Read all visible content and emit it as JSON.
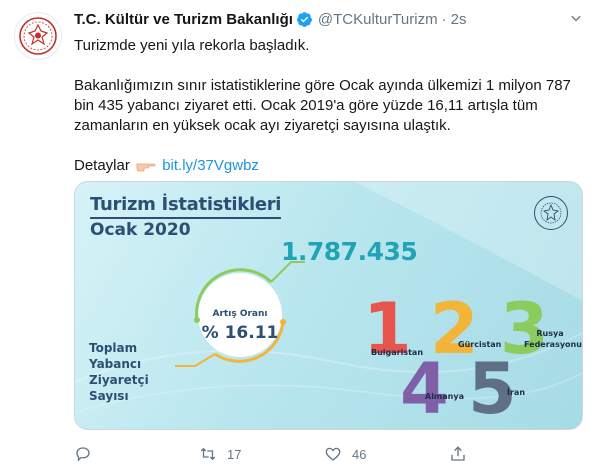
{
  "author": {
    "name": "T.C. Kültür ve Turizm Bakanlığı",
    "handle": "@TCKulturTurizm",
    "separator": "·",
    "time": "2s"
  },
  "tweet": {
    "line1": "Turizmde yeni yıla rekorla başladık.",
    "line2": "Bakanlığımızın sınır istatistiklerine göre Ocak ayında ülkemizi 1 milyon 787 bin 435 yabancı ziyaret etti. Ocak 2019'a göre yüzde 16,11 artışla tüm zamanların en yüksek ocak ayı ziyaretçi sayısına ulaştık.",
    "details_label": "Detaylar",
    "link": "bit.ly/37Vgwbz"
  },
  "card": {
    "title": "Turizm İstatistikleri",
    "subtitle": "Ocak 2020",
    "total": "1.787.435",
    "rate_label": "Artış Oranı",
    "rate_value": "% 16.11",
    "visitor_label_1": "Toplam Yabancı",
    "visitor_label_2": "Ziyaretçi Sayısı",
    "ranks": [
      {
        "num": "1",
        "country": "Bulgaristan",
        "color": "#e8554e"
      },
      {
        "num": "2",
        "country": "Gürcistan",
        "color": "#f3b43a"
      },
      {
        "num": "3",
        "country": "Rusya Federasyonu",
        "color": "#8ccb5e"
      },
      {
        "num": "4",
        "country": "Almanya",
        "color": "#7e5fa8"
      },
      {
        "num": "5",
        "country": "İran",
        "color": "#5f6f86"
      }
    ]
  },
  "actions": {
    "reply_count": "",
    "retweet_count": "17",
    "like_count": "46"
  },
  "colors": {
    "link": "#1b95e0",
    "verified": "#1da1f2",
    "muted": "#657786",
    "card_text": "#2c4f74",
    "card_accent": "#1fa3b5"
  },
  "icons": [
    "emblem-icon",
    "verified-badge-icon",
    "chevron-down-icon",
    "pointing-hand-emoji",
    "reply-icon",
    "retweet-icon",
    "like-icon",
    "share-icon"
  ]
}
